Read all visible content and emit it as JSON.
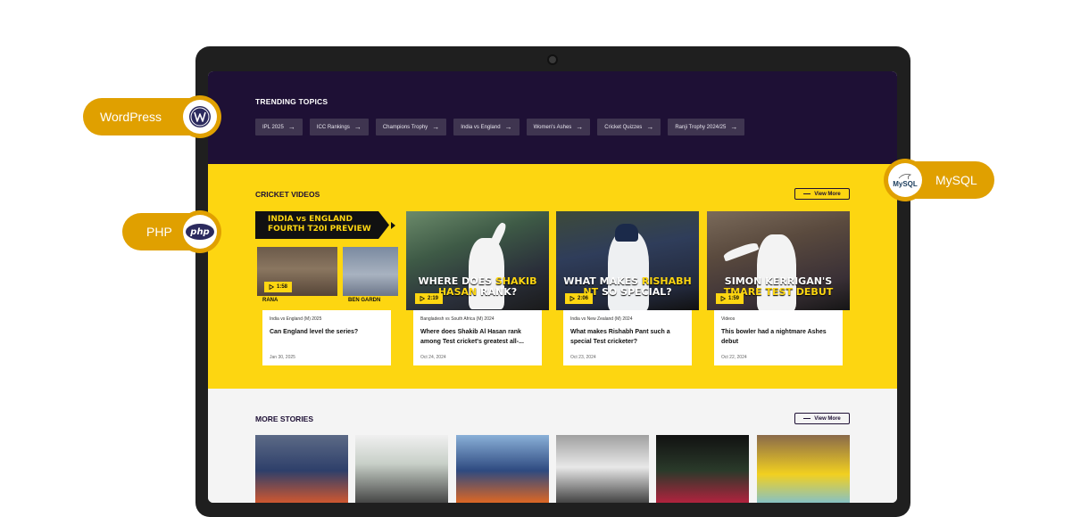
{
  "trending": {
    "title": "TRENDING TOPICS",
    "chips": [
      "IPL 2025",
      "ICC Rankings",
      "Champions Trophy",
      "India vs England",
      "Women's Ashes",
      "Cricket Quizzes",
      "Ranji Trophy 2024/25"
    ]
  },
  "videos": {
    "title": "CRICKET VIDEOS",
    "view_more": "View More",
    "cards": [
      {
        "banner": "INDIA vs ENGLAND FOURTH T20I PREVIEW",
        "name_left": "RANA",
        "name_right": "BEN GARDN",
        "duration": "1:58",
        "category": "India vs England (M) 2025",
        "title": "Can England level the series?",
        "date": "Jan 30, 2025"
      },
      {
        "headline_a": "WHERE DOES ",
        "headline_b": "SHAKIB",
        "headline_c": "HASAN",
        "headline_d": " RANK?",
        "duration": "2:19",
        "category": "Bangladesh vs South Africa (M) 2024",
        "title": "Where does Shakib Al Hasan rank among Test cricket's greatest all-...",
        "date": "Oct 24, 2024"
      },
      {
        "headline_a": "WHAT MAKES ",
        "headline_b": "RISHABH",
        "headline_c": "NT",
        "headline_d": " SO SPECIAL?",
        "duration": "2:06",
        "category": "India vs New Zealand (M) 2024",
        "title": "What makes Rishabh Pant such a special Test cricketer?",
        "date": "Oct 23, 2024"
      },
      {
        "headline_a": "SIMON KERRIGAN'S",
        "headline_c": "TMARE TEST DEBUT",
        "duration": "1:59",
        "category": "Videos",
        "title": "This bowler had a nightmare Ashes debut",
        "date": "Oct 22, 2024"
      }
    ]
  },
  "stories": {
    "title": "MORE STORIES",
    "view_more": "View More"
  },
  "badges": {
    "wordpress": "WordPress",
    "php": "PHP",
    "mysql": "MySQL",
    "php_logo": "php",
    "mysql_logo": "MySQL"
  },
  "colors": {
    "accent": "#fdd611",
    "dark": "#1e1035",
    "badge": "#e0a000"
  },
  "icons": [
    "play-icon",
    "arrow-right-icon",
    "wordpress-logo-icon",
    "php-logo-icon",
    "mysql-logo-icon",
    "camera-icon"
  ]
}
